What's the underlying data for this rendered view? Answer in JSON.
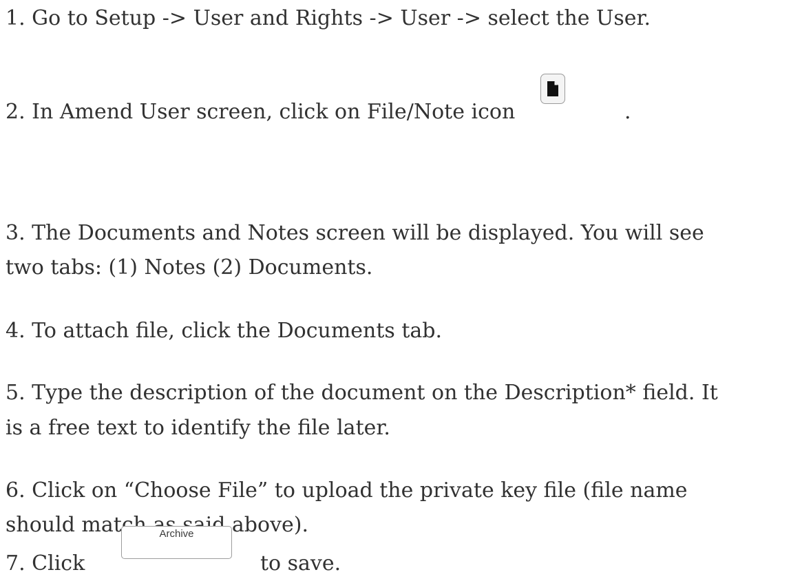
{
  "steps": {
    "s1": "1. Go to Setup -> User and Rights -> User -> select the User.",
    "s2": "2. In Amend User screen, click on File/Note icon",
    "s2_end": ".",
    "s3_line1": "3. The Documents and Notes screen will be displayed. You will see",
    "s3_line2": "two tabs: (1) Notes (2) Documents.",
    "s4": "4. To attach file, click the Documents tab.",
    "s5_line1": "5. Type the description of the document on the Description* field. It",
    "s5_line2": "is a free text to identify the file later.",
    "s6_line1": "6. Click on “Choose File” to upload the private key file (file name",
    "s6_line2": "should match as said above).",
    "s7_prefix": "7. Click",
    "s7_suffix": "to save."
  },
  "buttons": {
    "archive_label": "Archive",
    "file_note_icon": "file-note-icon"
  }
}
